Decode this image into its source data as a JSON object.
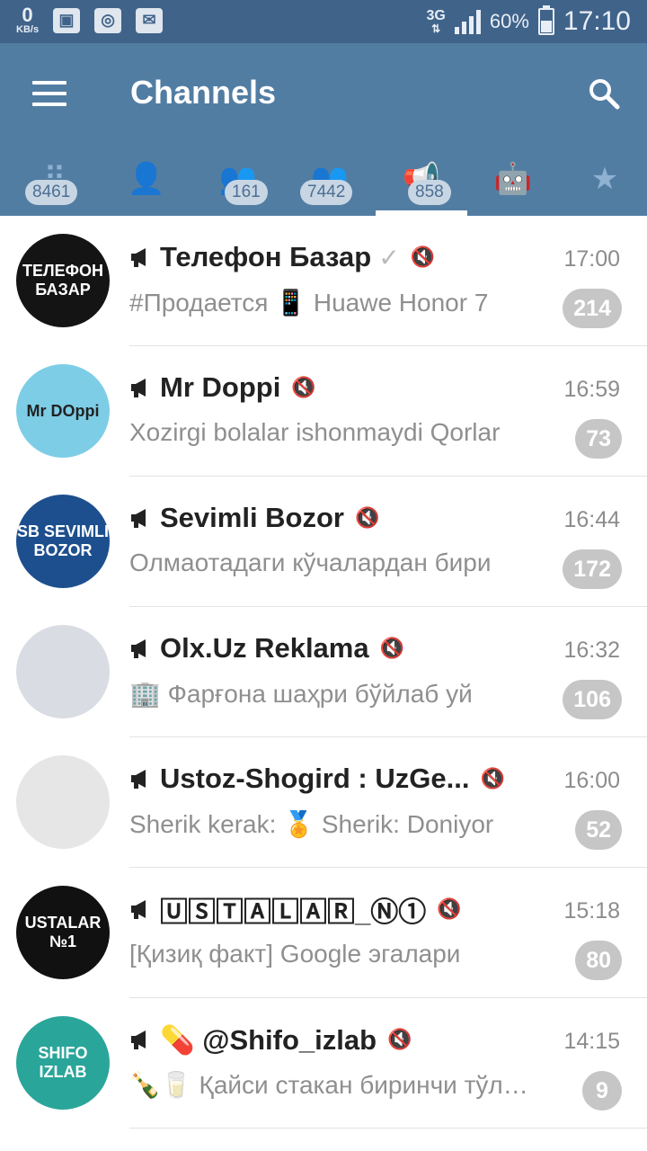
{
  "statusbar": {
    "kbs_value": "0",
    "kbs_unit": "KB/s",
    "network": "3G",
    "battery": "60%",
    "battery_level": 0.6,
    "time": "17:10"
  },
  "appbar": {
    "title": "Channels",
    "menu_icon": "menu-icon",
    "search_icon": "search-icon"
  },
  "tabs": [
    {
      "icon": "all-chats-icon",
      "badge": "8461"
    },
    {
      "icon": "user-icon",
      "badge": ""
    },
    {
      "icon": "group-icon",
      "badge": "161"
    },
    {
      "icon": "supergroup-icon",
      "badge": "7442"
    },
    {
      "icon": "channel-megaphone-icon",
      "badge": "858",
      "active": true
    },
    {
      "icon": "bot-icon",
      "badge": ""
    },
    {
      "icon": "star-icon",
      "badge": ""
    }
  ],
  "colors": {
    "statusbar": "#40638a",
    "appbar": "#527da3",
    "counter": "#c6c6c6"
  },
  "chats": [
    {
      "name": "Телефон Базар",
      "verified": true,
      "muted": true,
      "time": "17:00",
      "preview": "#Продается 📱 Huawe Honor 7",
      "count": "214",
      "avatar_text": "ТЕЛЕФОН БАЗАР",
      "avatar_color": "#141414"
    },
    {
      "name": "Mr Doppi",
      "verified": false,
      "muted": true,
      "time": "16:59",
      "preview": "Xozirgi bolalar ishonmaydi Qorlar",
      "count": "73",
      "avatar_text": "Mr DOppi",
      "avatar_color": "#7dcde6"
    },
    {
      "name": "Sevimli Bozor",
      "verified": false,
      "muted": true,
      "time": "16:44",
      "preview": "Олмаотадаги кўчалардан бири",
      "count": "172",
      "avatar_text": "SB SEVIMLI BOZOR",
      "avatar_color": "#1d4f8e"
    },
    {
      "name": "Olx.Uz Reklama",
      "verified": false,
      "muted": true,
      "time": "16:32",
      "preview": "🏢 Фарғона шаҳри бўйлаб уй",
      "count": "106",
      "avatar_text": "",
      "avatar_color": "#d9dde3"
    },
    {
      "name": "Ustoz-Shogird : UzGe...",
      "verified": false,
      "muted": true,
      "time": "16:00",
      "preview": "Sherik  kerak:  🏅 Sherik: Doniyor",
      "count": "52",
      "avatar_text": "",
      "avatar_color": "#e6e6e6"
    },
    {
      "name": "🅄🅂🅃🄰🄻🄰🅁_Ⓝ①",
      "verified": false,
      "muted": true,
      "time": "15:18",
      "preview": "[Қизиқ факт]  Google эгалари",
      "count": "80",
      "avatar_text": "USTALAR №1",
      "avatar_color": "#111111"
    },
    {
      "name": "💊 @Shifo_izlab",
      "verified": false,
      "muted": true,
      "time": "14:15",
      "preview": "🍾🥛 Қайси стакан биринчи тўлади",
      "count": "9",
      "avatar_text": "SHIFO IZLAB",
      "avatar_color": "#2aa59a"
    }
  ]
}
